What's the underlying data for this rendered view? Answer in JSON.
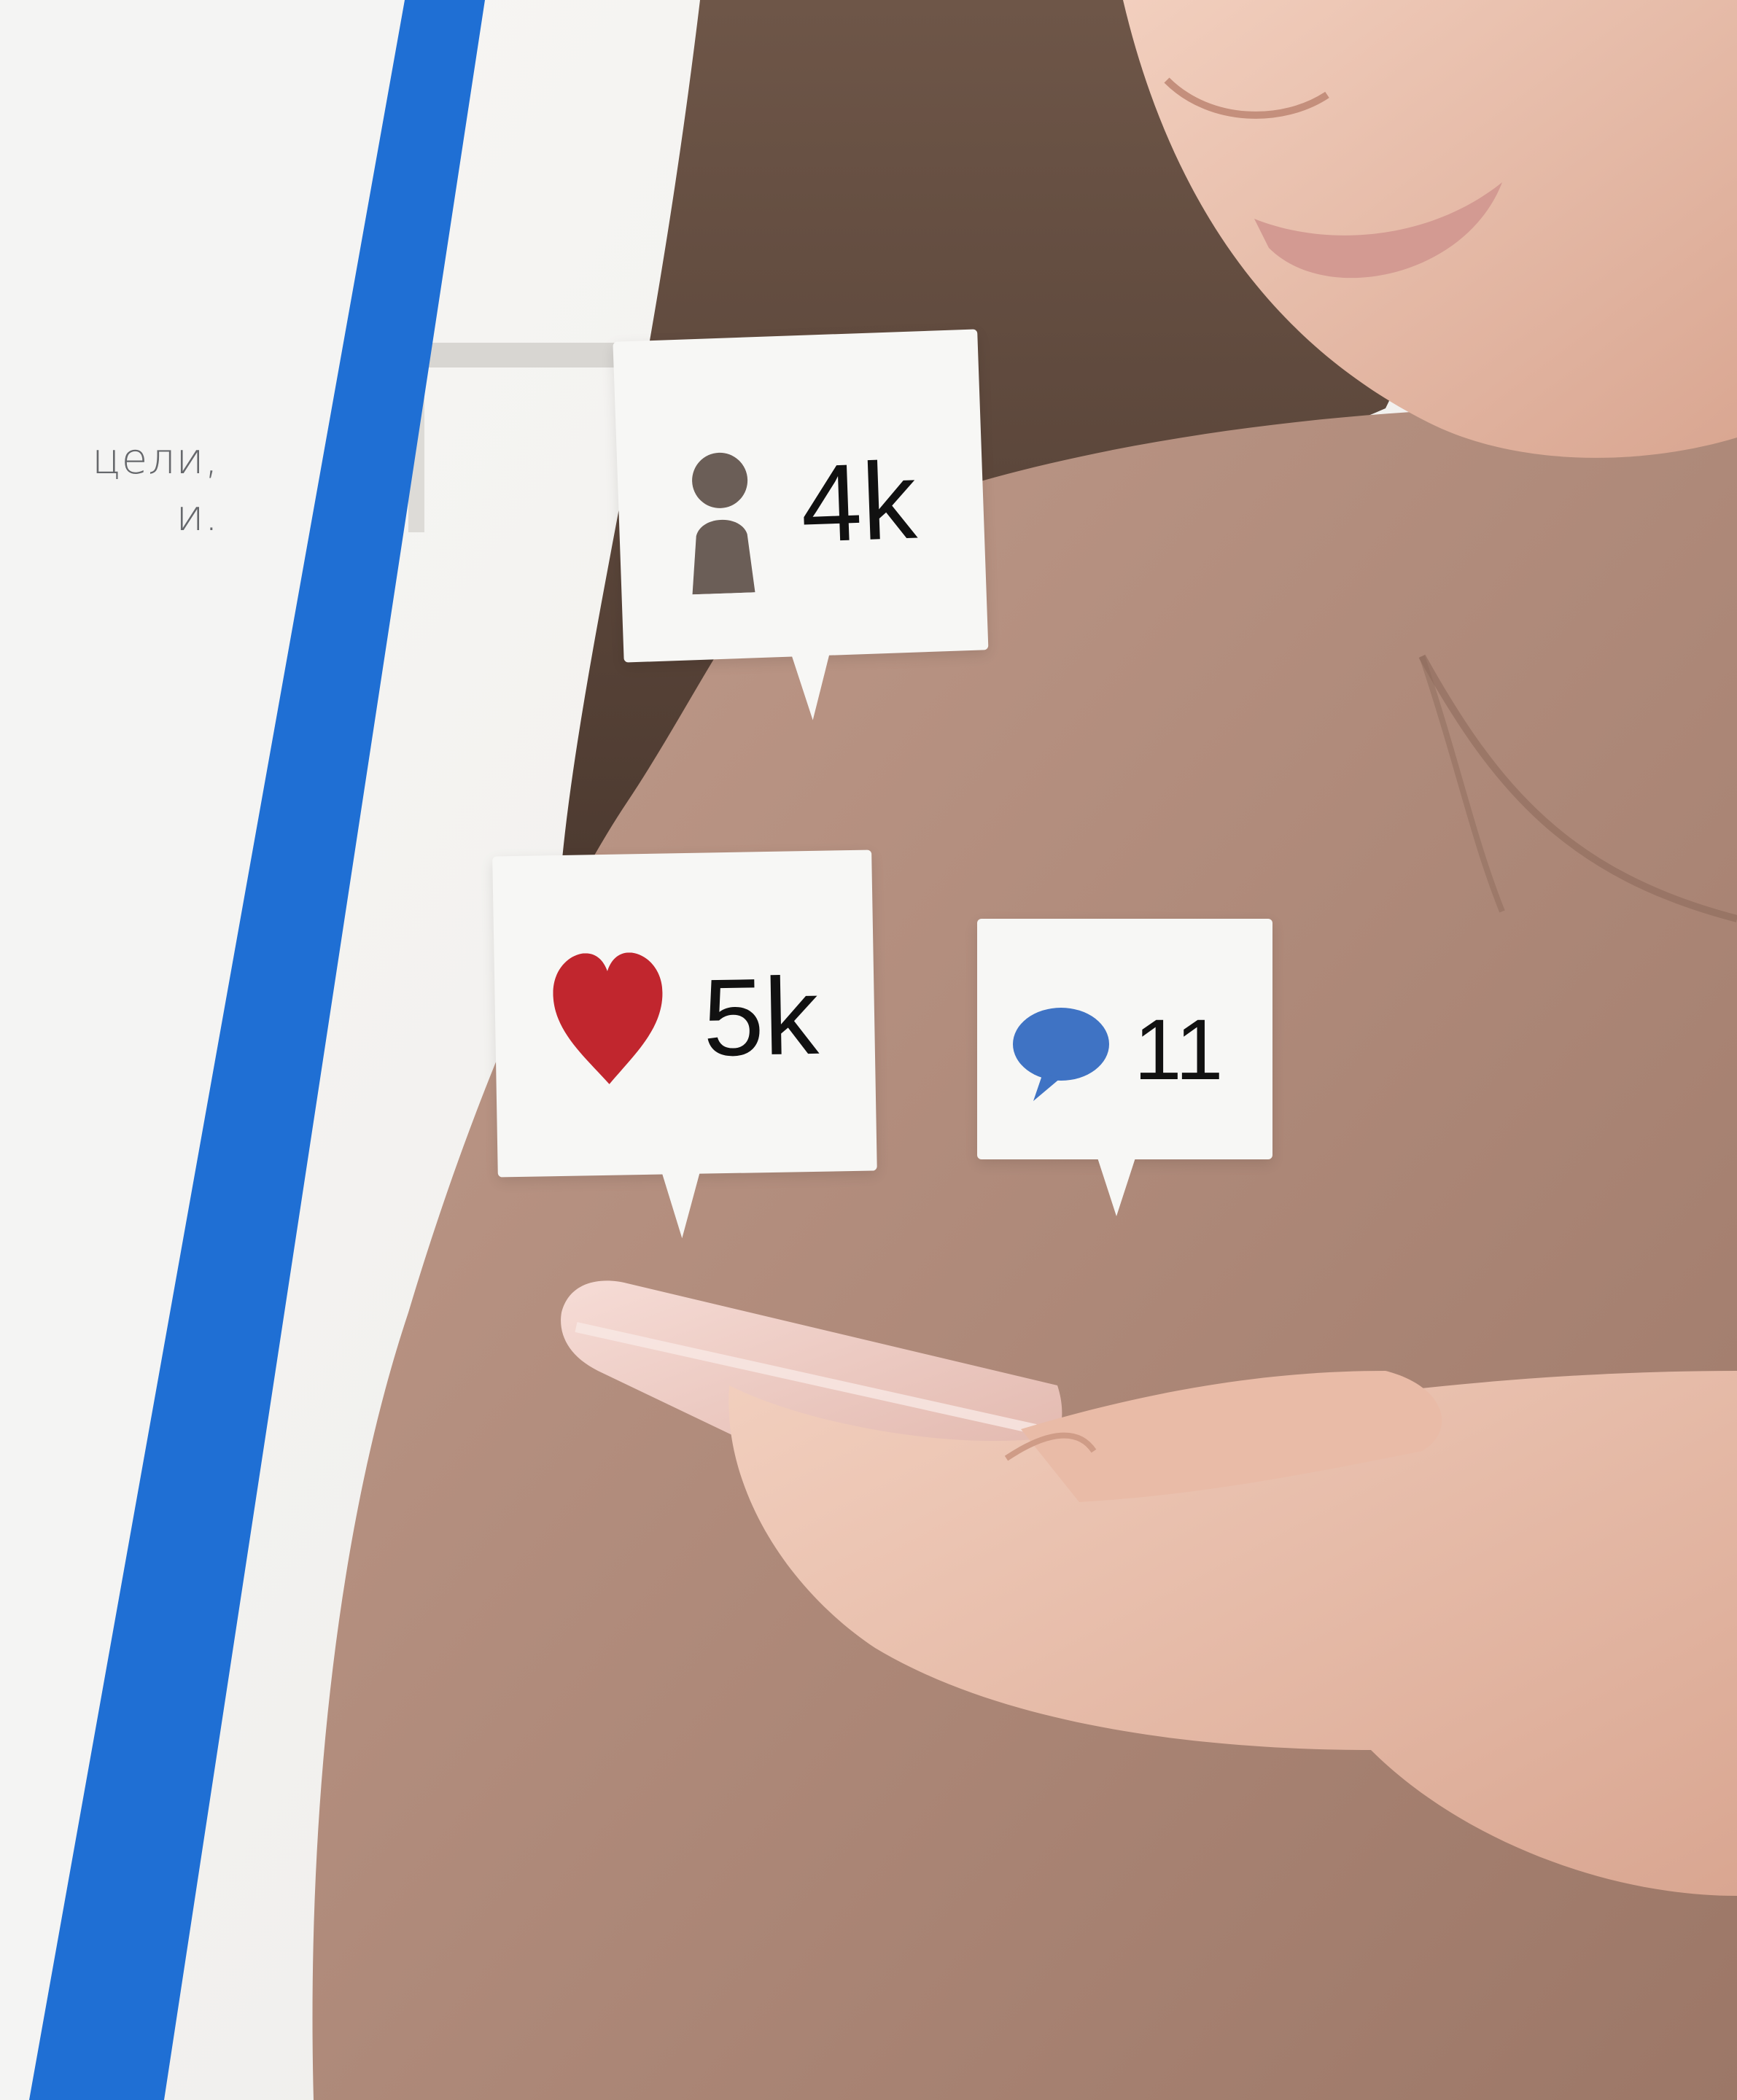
{
  "panel": {
    "lines": [
      "цели,",
      "и."
    ]
  },
  "bubbles": {
    "followers": {
      "icon": "person-icon",
      "count": "4k"
    },
    "likes": {
      "icon": "heart-icon",
      "count": "5k"
    },
    "comments": {
      "icon": "speech-bubble-icon",
      "count": "11"
    }
  },
  "colors": {
    "accent_stripe": "#1f6fd4",
    "panel_bg": "#f4f4f3",
    "heart": "#c1262e",
    "comment": "#3f73c4",
    "person": "#6b5e57"
  }
}
